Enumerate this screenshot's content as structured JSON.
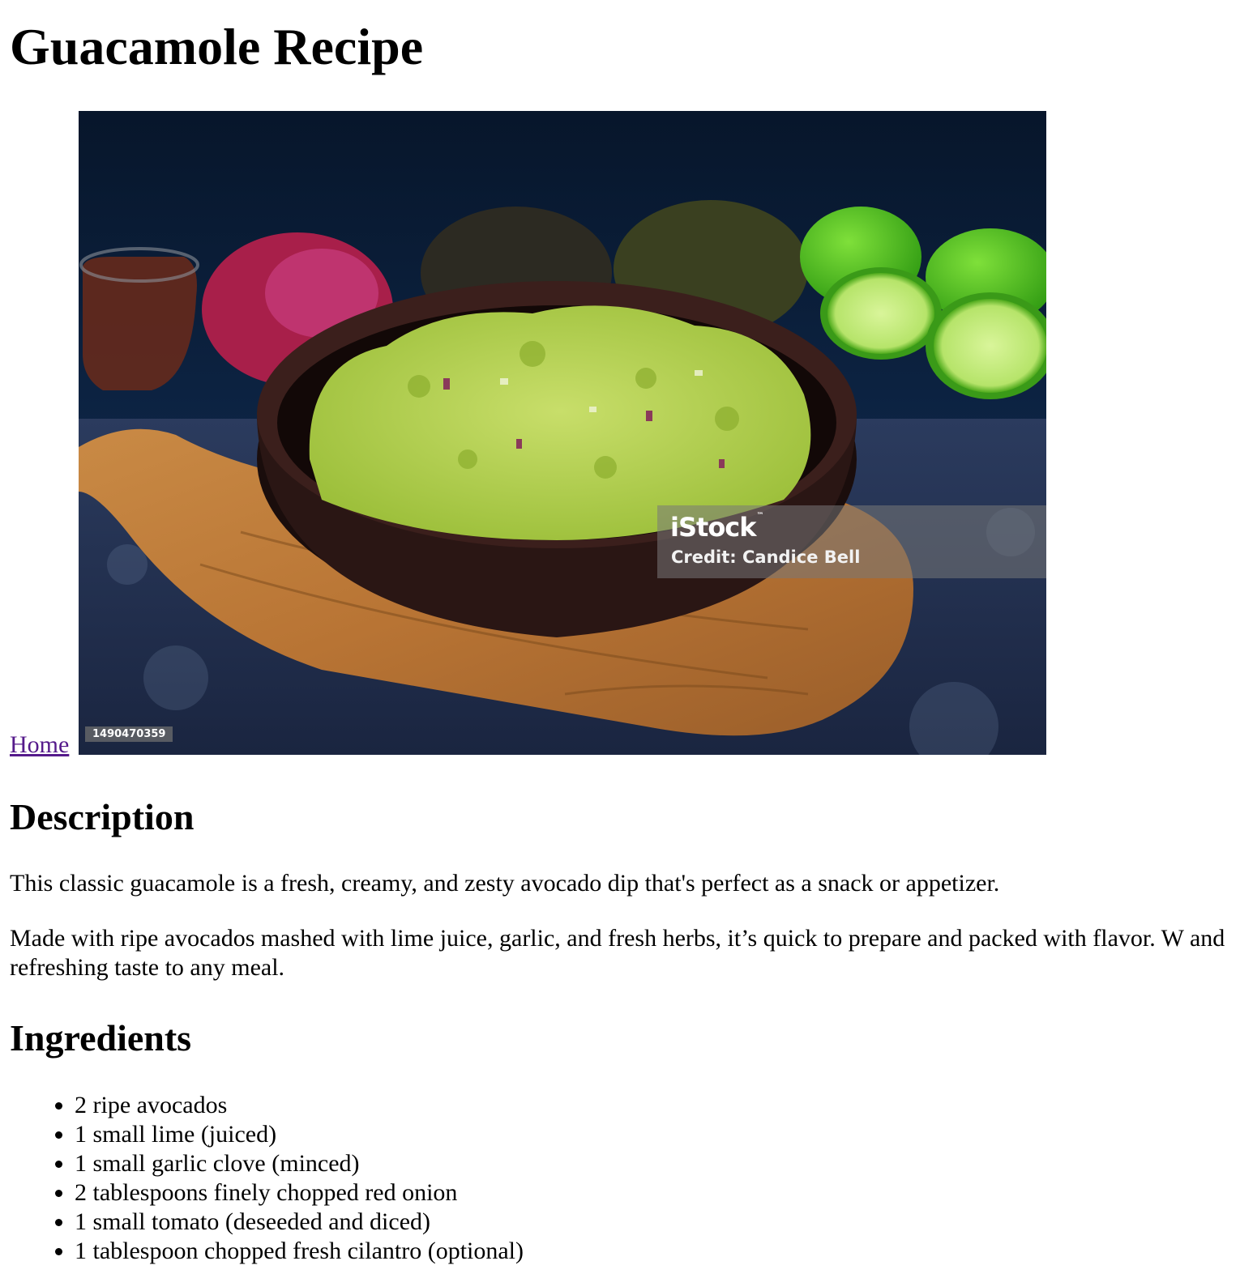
{
  "page": {
    "title": "Guacamole Recipe",
    "home_link": "Home"
  },
  "hero_image": {
    "brand": "iStock",
    "brand_mark": "™",
    "credit": "Credit: Candice Bell",
    "stock_id": "1490470359"
  },
  "description": {
    "heading": "Description",
    "paragraphs": [
      "This classic guacamole is a fresh, creamy, and zesty avocado dip that's perfect as a snack or appetizer.",
      "Made with ripe avocados mashed with lime juice, garlic, and fresh herbs, it’s quick to prepare and packed with flavor. W and refreshing taste to any meal."
    ]
  },
  "ingredients": {
    "heading": "Ingredients",
    "items": [
      "2 ripe avocados",
      "1 small lime (juiced)",
      "1 small garlic clove (minced)",
      "2 tablespoons finely chopped red onion",
      "1 small tomato (deseeded and diced)",
      "1 tablespoon chopped fresh cilantro (optional)"
    ]
  }
}
